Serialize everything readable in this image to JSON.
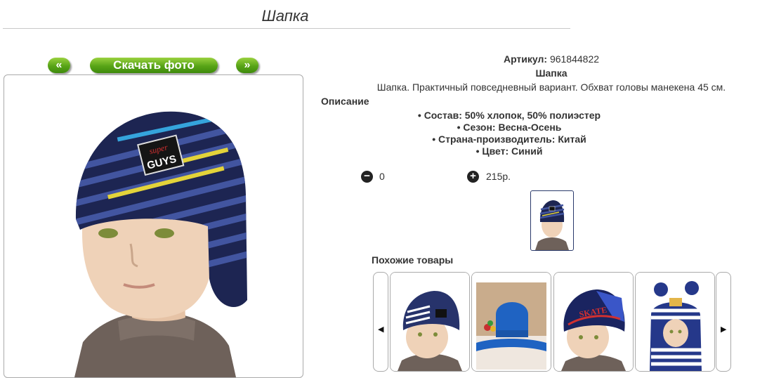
{
  "page": {
    "title": "Шапка"
  },
  "nav": {
    "prev": "«",
    "download": "Скачать фото",
    "next": "»"
  },
  "product": {
    "article_label": "Артикул:",
    "article_value": "961844822",
    "name": "Шапка",
    "description": "Шапка. Практичный повседневный вариант. Обхват головы манекена 45 см.",
    "description_title": "Описание",
    "features": [
      "Состав: 50% хлопок, 50% полиэстер",
      "Сезон: Весна-Осень",
      "Страна-производитель: Китай",
      "Цвет: Синий"
    ]
  },
  "cart": {
    "minus": "−",
    "plus": "+",
    "quantity": "0",
    "price": "215р."
  },
  "hero_photo_text": {
    "line1": "super",
    "line2": "GUYS"
  },
  "similar": {
    "title": "Похожие товары",
    "prev_icon": "◀",
    "next_icon": "▶",
    "items": [
      {
        "icon": "beanie-white-stripes-photo",
        "hat_color": "#27336b",
        "accent": "#ffffff"
      },
      {
        "icon": "blue-beanie-on-fur-photo",
        "hat_color": "#1f63c2",
        "accent": "#1f63c2"
      },
      {
        "icon": "skate-helmet-hat-photo",
        "hat_color": "#1a2460",
        "accent": "#d23030",
        "text": "SKATE"
      },
      {
        "icon": "striped-pompom-hood-photo",
        "hat_color": "#25388a",
        "accent": "#ffffff"
      }
    ]
  },
  "colors": {
    "button_green": "#58a417",
    "hat_navy": "#1d2552",
    "hat_blue": "#4255a0",
    "hat_yellow": "#e3d33a",
    "hat_cyan": "#35a4dc",
    "sweater": "#6e615a"
  }
}
